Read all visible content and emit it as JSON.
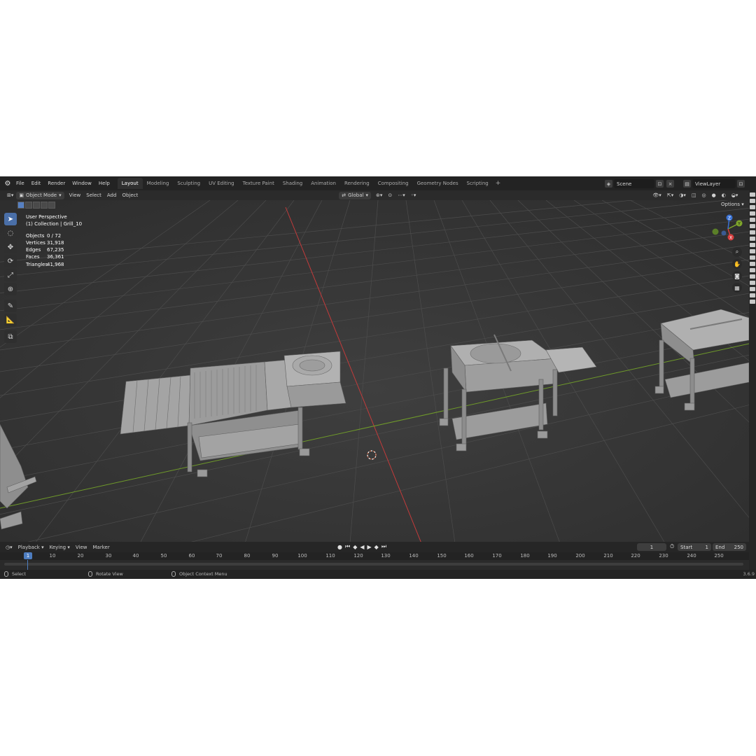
{
  "menu": {
    "items": [
      "File",
      "Edit",
      "Render",
      "Window",
      "Help"
    ]
  },
  "workspaces": [
    "Layout",
    "Modeling",
    "Sculpting",
    "UV Editing",
    "Texture Paint",
    "Shading",
    "Animation",
    "Rendering",
    "Compositing",
    "Geometry Nodes",
    "Scripting"
  ],
  "workspace_add": "+",
  "scene": {
    "label": "Scene",
    "view_layer": "ViewLayer"
  },
  "viewport_header": {
    "mode": "Object Mode",
    "view": "View",
    "select": "Select",
    "add": "Add",
    "object": "Object",
    "transform_orientation": "Global",
    "options": "Options"
  },
  "overlay_info": {
    "perspective": "User Perspective",
    "collection": "(1) Collection | Grill_10",
    "stats": [
      {
        "label": "Objects",
        "value": "0 / 72"
      },
      {
        "label": "Vertices",
        "value": "31,918"
      },
      {
        "label": "Edges",
        "value": "67,235"
      },
      {
        "label": "Faces",
        "value": "36,361"
      },
      {
        "label": "Triangles",
        "value": "41,968"
      }
    ]
  },
  "gizmo": {
    "x": "X",
    "y": "Y",
    "z": "Z"
  },
  "timeline": {
    "menus": [
      "Playback",
      "Keying",
      "View",
      "Marker"
    ],
    "current_frame": "1",
    "start_label": "Start",
    "start": "1",
    "end_label": "End",
    "end": "250",
    "ruler": [
      "1",
      "10",
      "20",
      "30",
      "40",
      "50",
      "60",
      "70",
      "80",
      "90",
      "100",
      "110",
      "120",
      "130",
      "140",
      "150",
      "160",
      "170",
      "180",
      "190",
      "200",
      "210",
      "220",
      "230",
      "240",
      "250"
    ]
  },
  "statusbar": {
    "select": "Select",
    "rotate": "Rotate View",
    "context": "Object Context Menu",
    "version": "3.6.9"
  },
  "colors": {
    "accent": "#4a6fa8",
    "x_axis": "#d63c3c",
    "y_axis": "#7fa62b",
    "z_axis": "#3b73d6"
  }
}
